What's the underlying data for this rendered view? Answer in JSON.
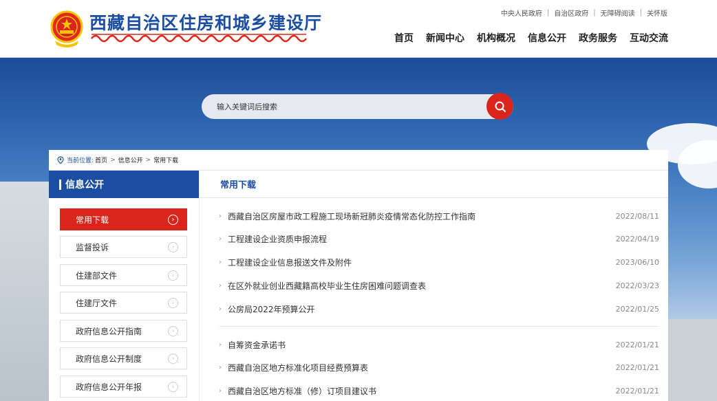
{
  "header": {
    "site_title": "西藏自治区住房和城乡建设厅",
    "top_links": [
      "中央人民政府",
      "自治区政府",
      "无障碍阅读",
      "关怀版"
    ],
    "nav": [
      "首页",
      "新闻中心",
      "机构概况",
      "信息公开",
      "政务服务",
      "互动交流"
    ]
  },
  "search": {
    "placeholder": "输入关键词后搜索"
  },
  "breadcrumb": {
    "label": "当前位置:",
    "items": [
      "首页",
      "信息公开",
      "常用下载"
    ]
  },
  "sidebar": {
    "title": "信息公开",
    "items": [
      {
        "label": "常用下载",
        "active": true
      },
      {
        "label": "监督投诉"
      },
      {
        "label": "住建部文件"
      },
      {
        "label": "住建厅文件"
      },
      {
        "label": "政府信息公开指南"
      },
      {
        "label": "政府信息公开制度"
      },
      {
        "label": "政府信息公开年报"
      }
    ]
  },
  "main": {
    "title": "常用下载",
    "rows": [
      {
        "title": "西藏自治区房屋市政工程施工现场新冠肺炎疫情常态化防控工作指南",
        "date": "2022/08/11"
      },
      {
        "title": "工程建设企业资质申报流程",
        "date": "2022/04/19"
      },
      {
        "title": "工程建设企业信息报送文件及附件",
        "date": "2023/06/10"
      },
      {
        "title": "在区外就业创业西藏籍高校毕业生住房困难问题调查表",
        "date": "2022/03/23"
      },
      {
        "title": "公房局2022年预算公开",
        "date": "2022/01/25"
      },
      {
        "title": "自筹资金承诺书",
        "date": "2022/01/21"
      },
      {
        "title": "西藏自治区地方标准化项目经费预算表",
        "date": "2022/01/21"
      },
      {
        "title": "西藏自治区地方标准（修）订项目建议书",
        "date": "2022/01/21"
      }
    ]
  },
  "colors": {
    "brand_blue": "#1b4da3",
    "accent_red": "#d9251c"
  }
}
